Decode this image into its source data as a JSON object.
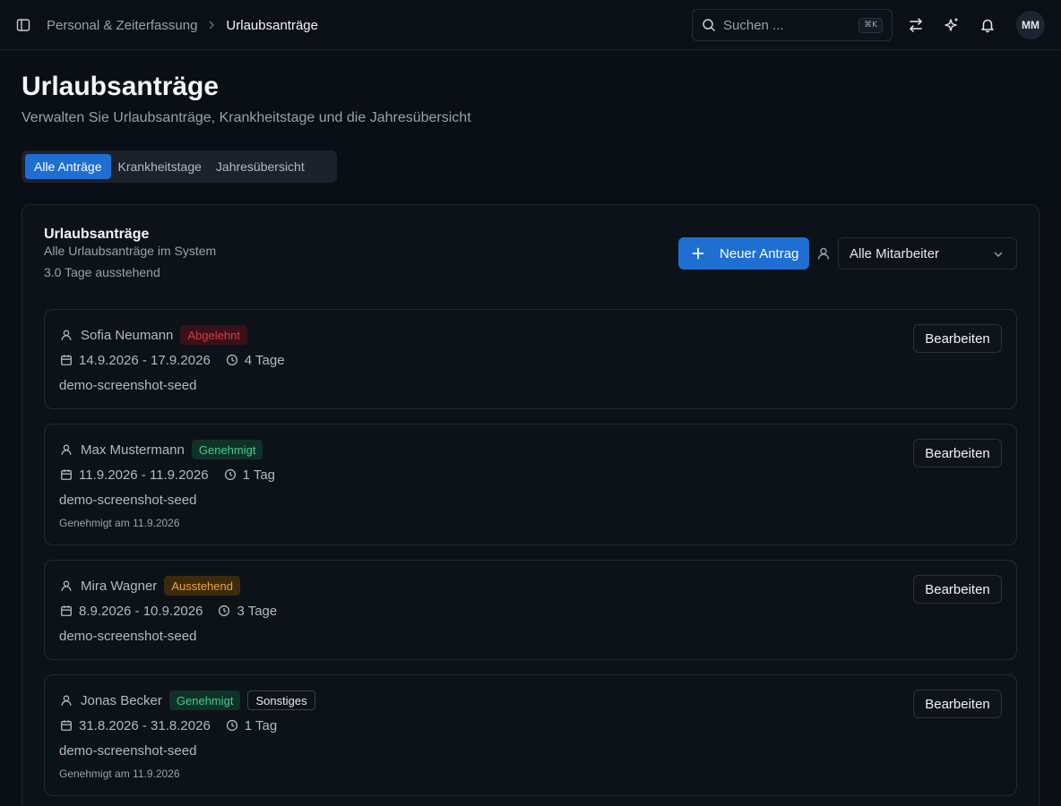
{
  "breadcrumb": {
    "parent": "Personal & Zeiterfassung",
    "current": "Urlaubsanträge"
  },
  "search": {
    "placeholder": "Suchen ...",
    "shortcut": "⌘K"
  },
  "user": {
    "initials": "MM"
  },
  "page": {
    "title": "Urlaubsanträge",
    "subtitle": "Verwalten Sie Urlaubsanträge, Krankheitstage und die Jahresübersicht"
  },
  "tabs": [
    {
      "label": "Alle Anträge",
      "active": true
    },
    {
      "label": "Krankheitstage",
      "active": false
    },
    {
      "label": "Jahresübersicht",
      "active": false
    }
  ],
  "card": {
    "title": "Urlaubsanträge",
    "description": "Alle Urlaubsanträge im System",
    "pending": "3.0 Tage ausstehend",
    "new_button": "Neuer Antrag",
    "filter_value": "Alle Mitarbeiter"
  },
  "requests": [
    {
      "name": "Sofia Neumann",
      "status": "Abgelehnt",
      "dates": "14.9.2026 - 17.9.2026",
      "duration": "4 Tage",
      "note": "demo-screenshot-seed",
      "edit": "Bearbeiten"
    },
    {
      "name": "Max Mustermann",
      "status": "Genehmigt",
      "dates": "11.9.2026 - 11.9.2026",
      "duration": "1 Tag",
      "note": "demo-screenshot-seed",
      "approved_at": "Genehmigt am 11.9.2026",
      "edit": "Bearbeiten"
    },
    {
      "name": "Mira Wagner",
      "status": "Ausstehend",
      "dates": "8.9.2026 - 10.9.2026",
      "duration": "3 Tage",
      "note": "demo-screenshot-seed",
      "edit": "Bearbeiten"
    },
    {
      "name": "Jonas Becker",
      "status": "Genehmigt",
      "type": "Sonstiges",
      "dates": "31.8.2026 - 31.8.2026",
      "duration": "1 Tag",
      "note": "demo-screenshot-seed",
      "approved_at": "Genehmigt am 11.9.2026",
      "edit": "Bearbeiten"
    }
  ]
}
